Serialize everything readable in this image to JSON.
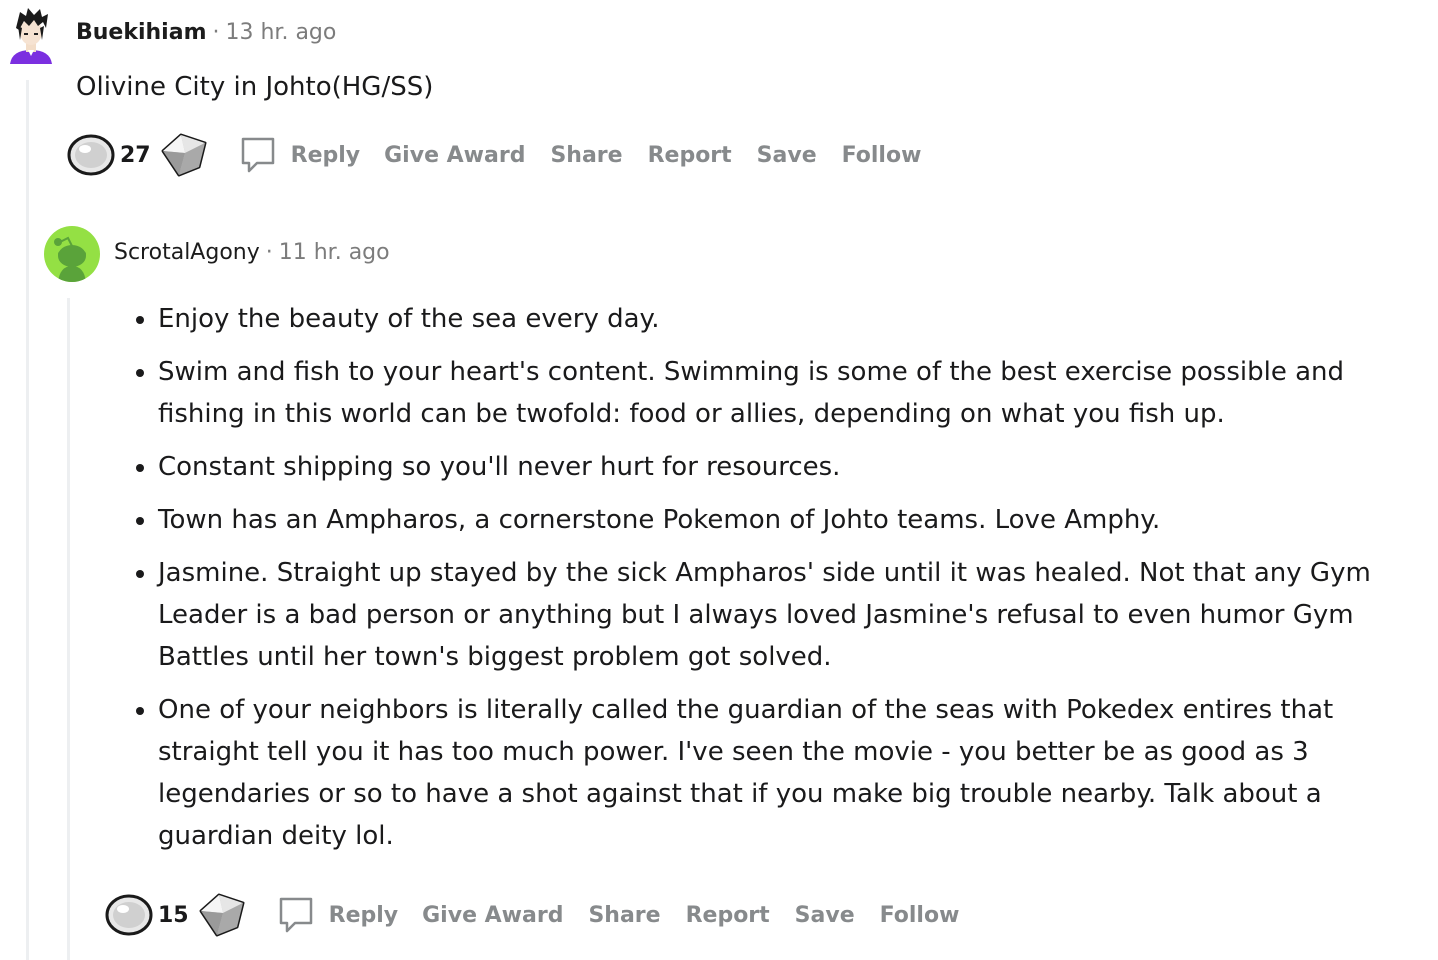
{
  "comments": [
    {
      "author": "Buekihiam",
      "timestamp": "13 hr. ago",
      "body": "Olivine City in Johto(HG/SS)",
      "score": "27",
      "actions": {
        "reply": "Reply",
        "award": "Give Award",
        "share": "Share",
        "report": "Report",
        "save": "Save",
        "follow": "Follow"
      }
    },
    {
      "author": "ScrotalAgony",
      "timestamp": "11 hr. ago",
      "bullets": [
        "Enjoy the beauty of the sea every day.",
        "Swim and fish to your heart's content. Swimming is some of the best exercise possible and fishing in this world can be twofold: food or allies, depending on what you fish up.",
        "Constant shipping so you'll never hurt for resources.",
        "Town has an Ampharos, a cornerstone Pokemon of Johto teams. Love Amphy.",
        "Jasmine. Straight up stayed by the sick Ampharos' side until it was healed. Not that any Gym Leader is a bad person or anything but I always loved Jasmine's refusal to even humor Gym Battles until her town's biggest problem got solved.",
        "One of your neighbors is literally called the guardian of the seas with Pokedex entires that straight tell you it has too much power. I've seen the movie - you better be as good as 3 legendaries or so to have a shot against that if you make big trouble nearby. Talk about a guardian deity lol."
      ],
      "score": "15",
      "actions": {
        "reply": "Reply",
        "award": "Give Award",
        "share": "Share",
        "report": "Report",
        "save": "Save",
        "follow": "Follow"
      }
    }
  ],
  "meta_separator": "·",
  "icons": {
    "vote": "upvote-icon",
    "award": "award-diamond-icon",
    "reply": "comment-bubble-icon",
    "avatar1": "anime-avatar-icon",
    "avatar2": "snoo-avatar-icon"
  },
  "colors": {
    "muted": "#878a8c",
    "thread_line": "#edeff1",
    "avatar2_bg": "#94e044"
  }
}
